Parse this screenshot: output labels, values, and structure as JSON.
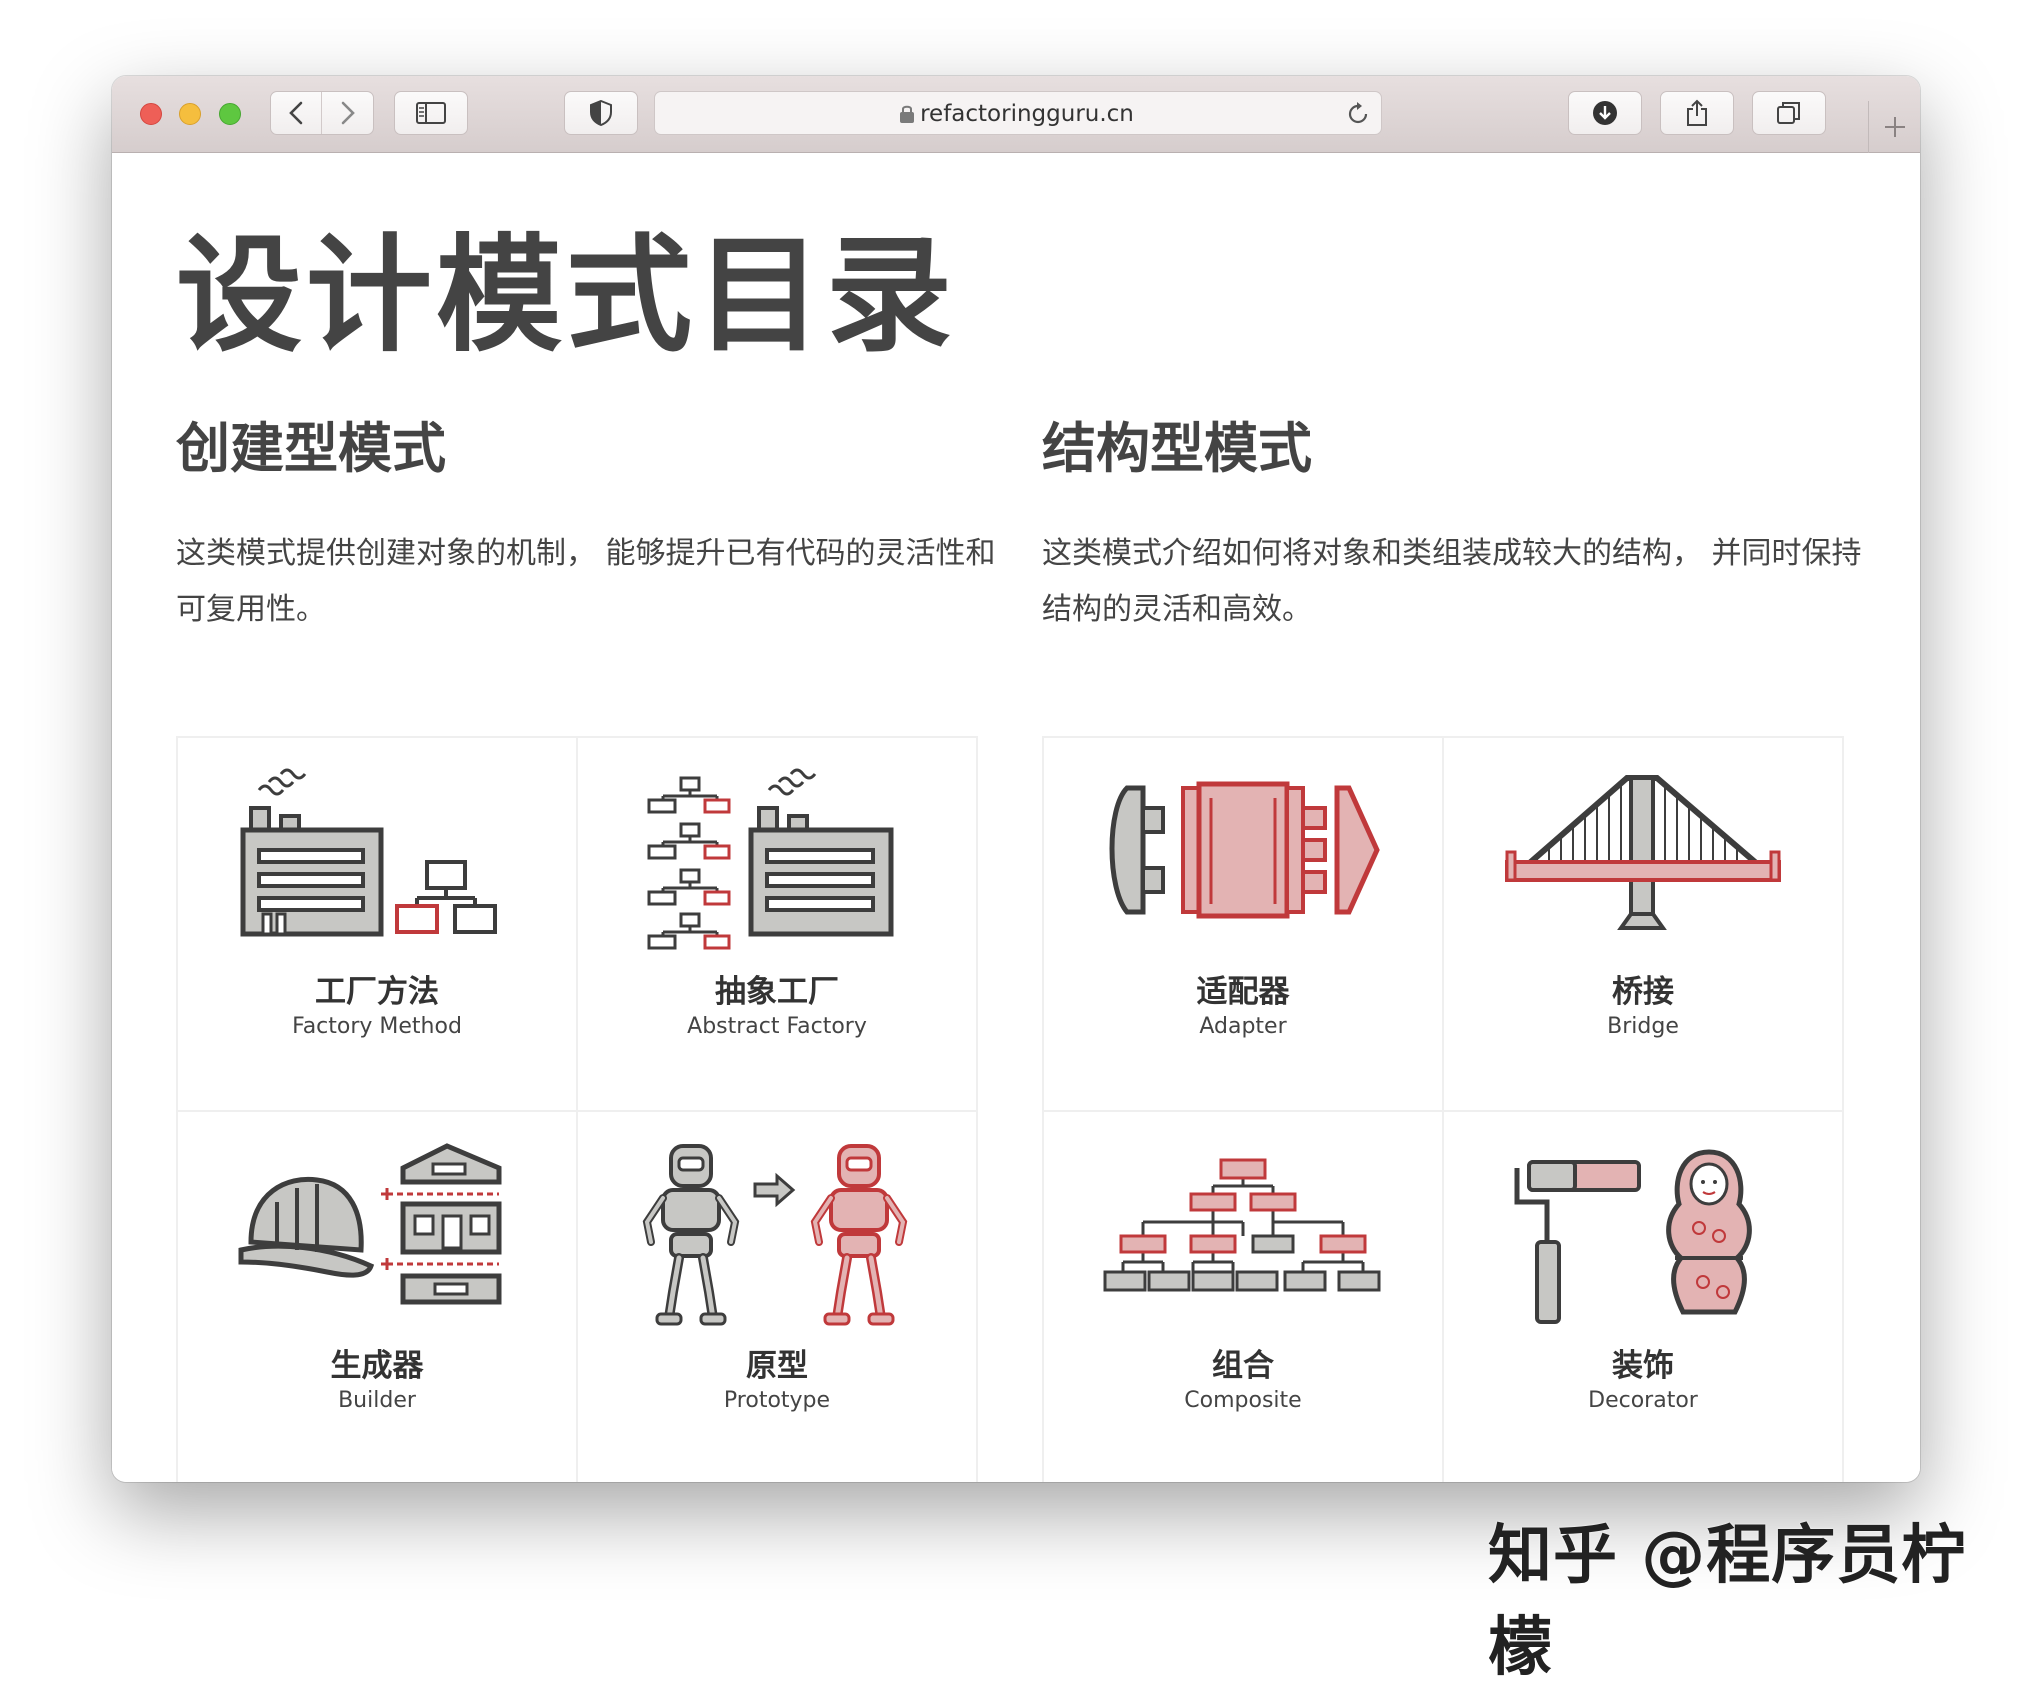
{
  "browser": {
    "url": "refactoringguru.cn",
    "icons": {
      "back": "chevron-left-icon",
      "forward": "chevron-right-icon",
      "sidebar": "sidebar-icon",
      "shield": "shield-icon",
      "lock": "lock-icon",
      "reload": "reload-icon",
      "download": "download-icon",
      "share": "share-icon",
      "tabs": "tabs-icon",
      "new_tab": "plus-icon"
    }
  },
  "page": {
    "title": "设计模式目录"
  },
  "sections": [
    {
      "title": "创建型模式",
      "description": "这类模式提供创建对象的机制， 能够提升已有代码的灵活性和可复用性。",
      "patterns": [
        {
          "name_cn": "工厂方法",
          "name_en": "Factory Method"
        },
        {
          "name_cn": "抽象工厂",
          "name_en": "Abstract Factory"
        },
        {
          "name_cn": "生成器",
          "name_en": "Builder"
        },
        {
          "name_cn": "原型",
          "name_en": "Prototype"
        }
      ]
    },
    {
      "title": "结构型模式",
      "description": "这类模式介绍如何将对象和类组装成较大的结构， 并同时保持结构的灵活和高效。",
      "patterns": [
        {
          "name_cn": "适配器",
          "name_en": "Adapter"
        },
        {
          "name_cn": "桥接",
          "name_en": "Bridge"
        },
        {
          "name_cn": "组合",
          "name_en": "Composite"
        },
        {
          "name_cn": "装饰",
          "name_en": "Decorator"
        }
      ]
    }
  ],
  "watermark": "知乎 @程序员柠檬",
  "colors": {
    "accent_red": "#c0393b",
    "pink_fill": "#e3b3b3",
    "gray_fill": "#c7c7c4",
    "stroke": "#3d3d3d"
  }
}
